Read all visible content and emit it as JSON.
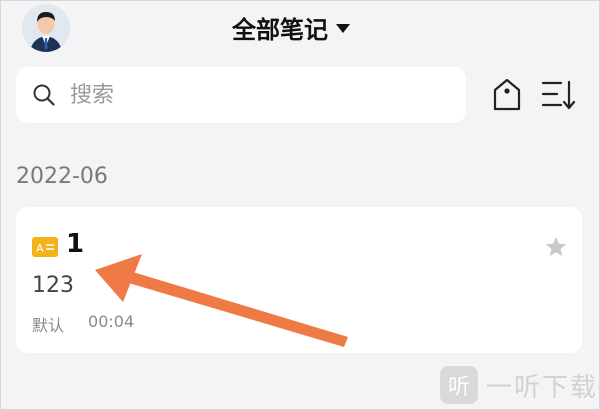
{
  "header": {
    "title": "全部笔记",
    "avatar_icon": "user-avatar"
  },
  "search": {
    "placeholder": "搜索"
  },
  "toolbar": {
    "tag_icon": "tag-icon",
    "sort_icon": "sort-icon"
  },
  "notes_section": {
    "date": "2022-06",
    "notes": [
      {
        "title": "1",
        "content": "123",
        "category": "默认",
        "time": "00:04",
        "starred": false
      }
    ]
  },
  "annotation": {
    "arrow_color": "#f07a46"
  },
  "watermark": {
    "logo": "听",
    "text": "一听下载"
  },
  "colors": {
    "background": "#f4f4f6",
    "card": "#ffffff",
    "badge": "#f4b21a"
  }
}
